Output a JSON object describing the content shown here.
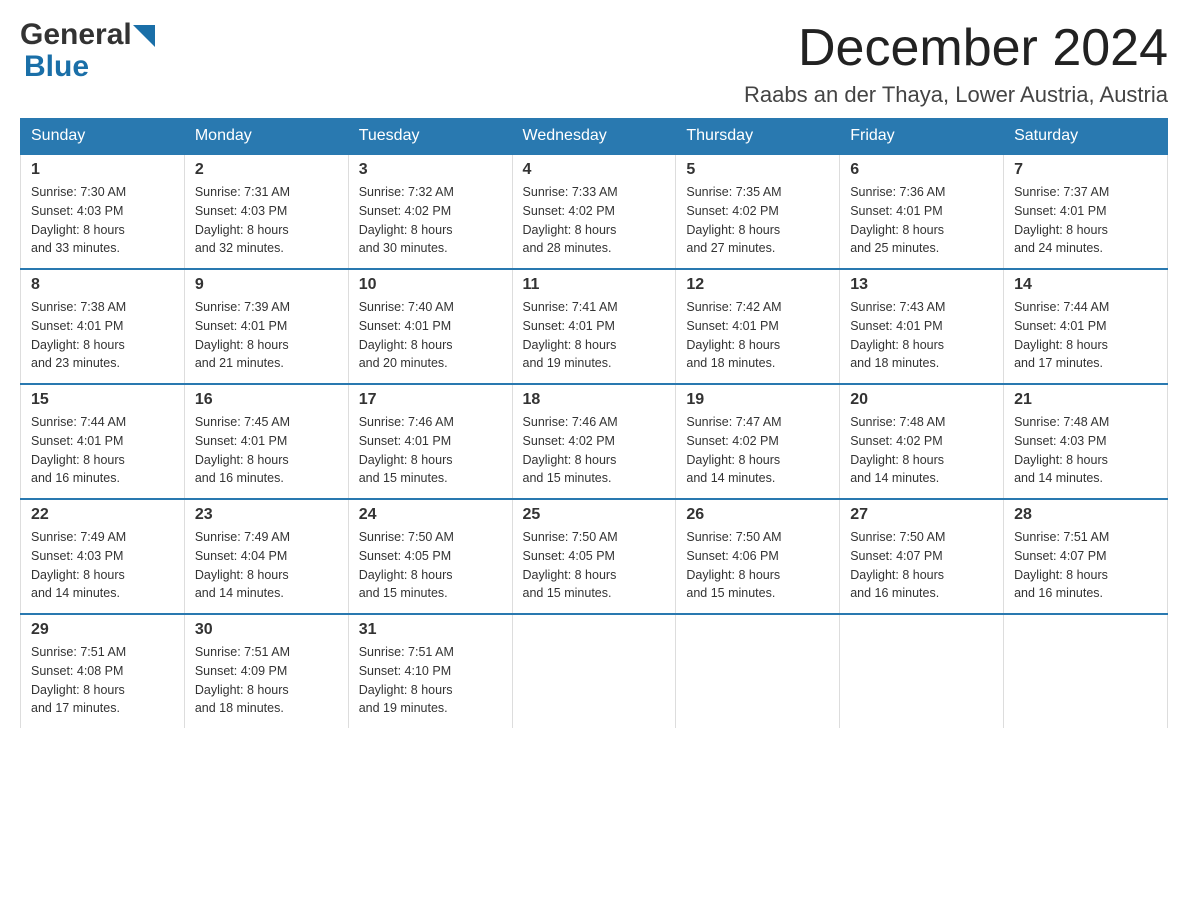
{
  "header": {
    "logo_general": "General",
    "logo_blue": "Blue",
    "main_title": "December 2024",
    "subtitle": "Raabs an der Thaya, Lower Austria, Austria"
  },
  "weekdays": [
    "Sunday",
    "Monday",
    "Tuesday",
    "Wednesday",
    "Thursday",
    "Friday",
    "Saturday"
  ],
  "weeks": [
    [
      {
        "day": "1",
        "sunrise": "7:30 AM",
        "sunset": "4:03 PM",
        "daylight": "8 hours and 33 minutes."
      },
      {
        "day": "2",
        "sunrise": "7:31 AM",
        "sunset": "4:03 PM",
        "daylight": "8 hours and 32 minutes."
      },
      {
        "day": "3",
        "sunrise": "7:32 AM",
        "sunset": "4:02 PM",
        "daylight": "8 hours and 30 minutes."
      },
      {
        "day": "4",
        "sunrise": "7:33 AM",
        "sunset": "4:02 PM",
        "daylight": "8 hours and 28 minutes."
      },
      {
        "day": "5",
        "sunrise": "7:35 AM",
        "sunset": "4:02 PM",
        "daylight": "8 hours and 27 minutes."
      },
      {
        "day": "6",
        "sunrise": "7:36 AM",
        "sunset": "4:01 PM",
        "daylight": "8 hours and 25 minutes."
      },
      {
        "day": "7",
        "sunrise": "7:37 AM",
        "sunset": "4:01 PM",
        "daylight": "8 hours and 24 minutes."
      }
    ],
    [
      {
        "day": "8",
        "sunrise": "7:38 AM",
        "sunset": "4:01 PM",
        "daylight": "8 hours and 23 minutes."
      },
      {
        "day": "9",
        "sunrise": "7:39 AM",
        "sunset": "4:01 PM",
        "daylight": "8 hours and 21 minutes."
      },
      {
        "day": "10",
        "sunrise": "7:40 AM",
        "sunset": "4:01 PM",
        "daylight": "8 hours and 20 minutes."
      },
      {
        "day": "11",
        "sunrise": "7:41 AM",
        "sunset": "4:01 PM",
        "daylight": "8 hours and 19 minutes."
      },
      {
        "day": "12",
        "sunrise": "7:42 AM",
        "sunset": "4:01 PM",
        "daylight": "8 hours and 18 minutes."
      },
      {
        "day": "13",
        "sunrise": "7:43 AM",
        "sunset": "4:01 PM",
        "daylight": "8 hours and 18 minutes."
      },
      {
        "day": "14",
        "sunrise": "7:44 AM",
        "sunset": "4:01 PM",
        "daylight": "8 hours and 17 minutes."
      }
    ],
    [
      {
        "day": "15",
        "sunrise": "7:44 AM",
        "sunset": "4:01 PM",
        "daylight": "8 hours and 16 minutes."
      },
      {
        "day": "16",
        "sunrise": "7:45 AM",
        "sunset": "4:01 PM",
        "daylight": "8 hours and 16 minutes."
      },
      {
        "day": "17",
        "sunrise": "7:46 AM",
        "sunset": "4:01 PM",
        "daylight": "8 hours and 15 minutes."
      },
      {
        "day": "18",
        "sunrise": "7:46 AM",
        "sunset": "4:02 PM",
        "daylight": "8 hours and 15 minutes."
      },
      {
        "day": "19",
        "sunrise": "7:47 AM",
        "sunset": "4:02 PM",
        "daylight": "8 hours and 14 minutes."
      },
      {
        "day": "20",
        "sunrise": "7:48 AM",
        "sunset": "4:02 PM",
        "daylight": "8 hours and 14 minutes."
      },
      {
        "day": "21",
        "sunrise": "7:48 AM",
        "sunset": "4:03 PM",
        "daylight": "8 hours and 14 minutes."
      }
    ],
    [
      {
        "day": "22",
        "sunrise": "7:49 AM",
        "sunset": "4:03 PM",
        "daylight": "8 hours and 14 minutes."
      },
      {
        "day": "23",
        "sunrise": "7:49 AM",
        "sunset": "4:04 PM",
        "daylight": "8 hours and 14 minutes."
      },
      {
        "day": "24",
        "sunrise": "7:50 AM",
        "sunset": "4:05 PM",
        "daylight": "8 hours and 15 minutes."
      },
      {
        "day": "25",
        "sunrise": "7:50 AM",
        "sunset": "4:05 PM",
        "daylight": "8 hours and 15 minutes."
      },
      {
        "day": "26",
        "sunrise": "7:50 AM",
        "sunset": "4:06 PM",
        "daylight": "8 hours and 15 minutes."
      },
      {
        "day": "27",
        "sunrise": "7:50 AM",
        "sunset": "4:07 PM",
        "daylight": "8 hours and 16 minutes."
      },
      {
        "day": "28",
        "sunrise": "7:51 AM",
        "sunset": "4:07 PM",
        "daylight": "8 hours and 16 minutes."
      }
    ],
    [
      {
        "day": "29",
        "sunrise": "7:51 AM",
        "sunset": "4:08 PM",
        "daylight": "8 hours and 17 minutes."
      },
      {
        "day": "30",
        "sunrise": "7:51 AM",
        "sunset": "4:09 PM",
        "daylight": "8 hours and 18 minutes."
      },
      {
        "day": "31",
        "sunrise": "7:51 AM",
        "sunset": "4:10 PM",
        "daylight": "8 hours and 19 minutes."
      },
      null,
      null,
      null,
      null
    ]
  ],
  "labels": {
    "sunrise": "Sunrise:",
    "sunset": "Sunset:",
    "daylight": "Daylight:"
  }
}
